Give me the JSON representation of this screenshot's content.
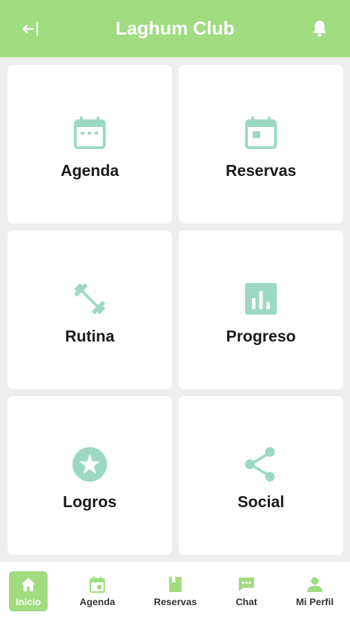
{
  "colors": {
    "header_bg": "#a1dc80",
    "icon_teal": "#9dd9c2",
    "card_bg": "#ffffff",
    "page_bg": "#eeeeee"
  },
  "header": {
    "title": "Laghum Club",
    "back_icon": "exit-arrow-icon",
    "bell_icon": "bell-icon"
  },
  "cards": [
    {
      "label": "Agenda",
      "icon": "calendar-icon"
    },
    {
      "label": "Reservas",
      "icon": "calendar-event-icon"
    },
    {
      "label": "Rutina",
      "icon": "dumbbell-icon"
    },
    {
      "label": "Progreso",
      "icon": "bar-chart-icon"
    },
    {
      "label": "Logros",
      "icon": "star-icon"
    },
    {
      "label": "Social",
      "icon": "share-icon"
    }
  ],
  "bottom_nav": [
    {
      "label": "Inicio",
      "icon": "home-icon",
      "active": true
    },
    {
      "label": "Agenda",
      "icon": "calendar-icon",
      "active": false
    },
    {
      "label": "Reservas",
      "icon": "book-icon",
      "active": false
    },
    {
      "label": "Chat",
      "icon": "chat-icon",
      "active": false
    },
    {
      "label": "Mi Perfil",
      "icon": "person-icon",
      "active": false
    }
  ]
}
